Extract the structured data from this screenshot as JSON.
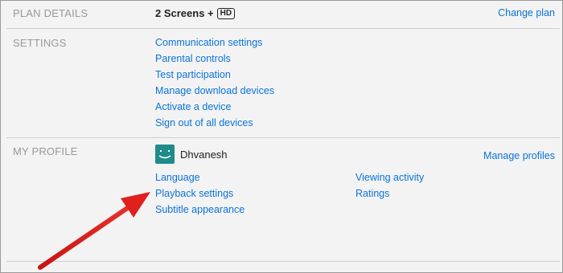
{
  "plan": {
    "label": "PLAN DETAILS",
    "screens": "2 Screens +",
    "quality_badge": "HD",
    "change_link": "Change plan"
  },
  "settings": {
    "label": "SETTINGS",
    "links": [
      "Communication settings",
      "Parental controls",
      "Test participation",
      "Manage download devices",
      "Activate a device",
      "Sign out of all devices"
    ]
  },
  "profile": {
    "label": "MY PROFILE",
    "name": "Dhvanesh",
    "manage_link": "Manage profiles",
    "left_links": [
      "Language",
      "Playback settings",
      "Subtitle appearance"
    ],
    "right_links": [
      "Viewing activity",
      "Ratings"
    ],
    "avatar_color": "#1f8b8b"
  },
  "annotation": {
    "arrow_color": "#e0201e"
  }
}
